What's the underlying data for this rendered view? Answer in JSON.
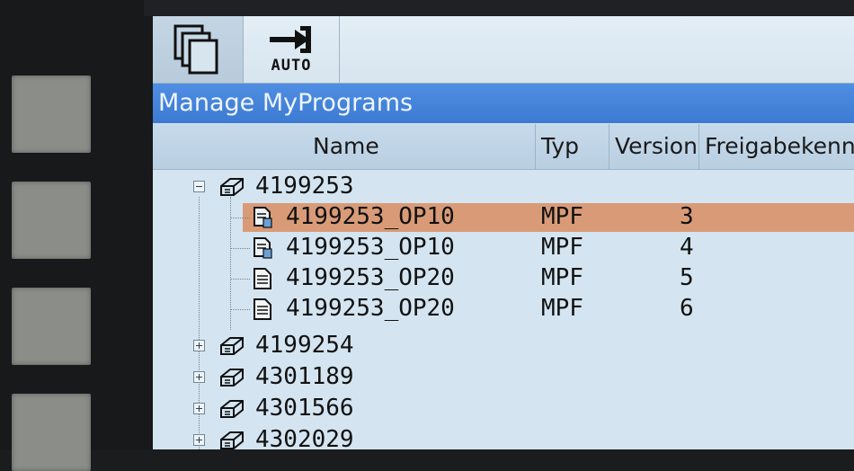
{
  "toolbar": {
    "buttons": [
      {
        "name": "windows-button",
        "icon": "windows-icon"
      },
      {
        "name": "auto-button",
        "icon": "auto-mode-icon",
        "label": "AUTO"
      }
    ]
  },
  "window": {
    "title": "Manage MyPrograms"
  },
  "table": {
    "columns": [
      "Name",
      "Typ",
      "Version",
      "Freigabekennu"
    ],
    "rows": [
      {
        "level": 0,
        "expander": "minus",
        "icon": "workpiece-icon",
        "name": "4199253",
        "type": "",
        "version": ""
      },
      {
        "level": 1,
        "icon": "program-copy-icon",
        "name": "4199253_OP10",
        "type": "MPF",
        "version": "3",
        "selected": true
      },
      {
        "level": 1,
        "icon": "program-copy-icon",
        "name": "4199253_OP10",
        "type": "MPF",
        "version": "4"
      },
      {
        "level": 1,
        "icon": "program-file-icon",
        "name": "4199253_OP20",
        "type": "MPF",
        "version": "5"
      },
      {
        "level": 1,
        "icon": "program-file-icon",
        "name": "4199253_OP20",
        "type": "MPF",
        "version": "6"
      },
      {
        "level": 0,
        "expander": "plus",
        "icon": "workpiece-icon",
        "name": "4199254",
        "type": "",
        "version": ""
      },
      {
        "level": 0,
        "expander": "plus",
        "icon": "workpiece-icon",
        "name": "4301189",
        "type": "",
        "version": ""
      },
      {
        "level": 0,
        "expander": "plus",
        "icon": "workpiece-icon",
        "name": "4301566",
        "type": "",
        "version": ""
      },
      {
        "level": 0,
        "expander": "plus",
        "icon": "workpiece-icon",
        "name": "4302029",
        "type": "",
        "version": ""
      }
    ]
  },
  "colors": {
    "title_bar": "#3f7fd6",
    "selection": "#d99b77",
    "background": "#d4e5f1"
  }
}
